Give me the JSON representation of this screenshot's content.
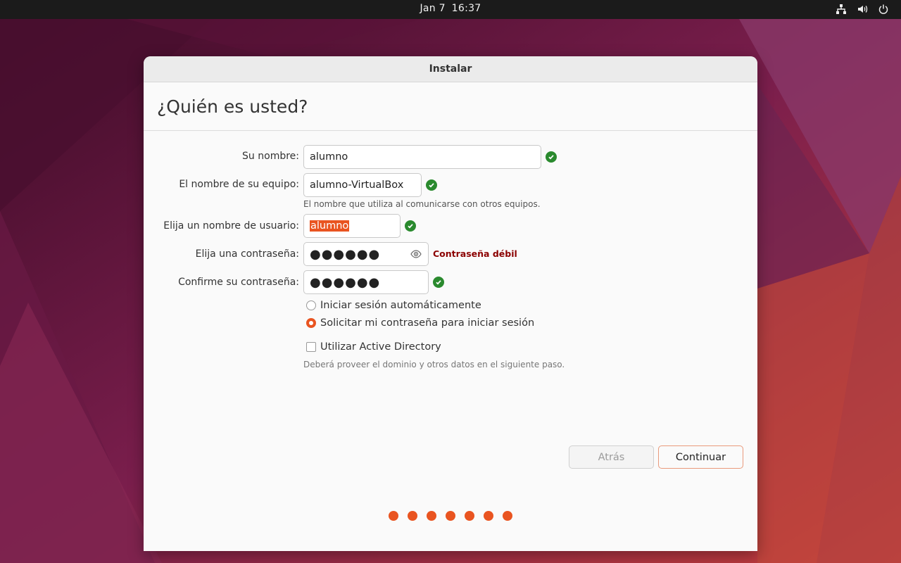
{
  "topbar": {
    "date": "Jan 7",
    "time": "16:37",
    "icons": [
      "network-icon",
      "volume-icon",
      "power-icon"
    ]
  },
  "window": {
    "title": "Instalar",
    "heading": "¿Quién es usted?"
  },
  "form": {
    "name_label": "Su nombre:",
    "name_value": "alumno",
    "computer_label": "El nombre de su equipo:",
    "computer_value": "alumno-VirtualBox",
    "computer_hint": "El nombre que utiliza al comunicarse con otros equipos.",
    "username_label": "Elija un nombre de usuario:",
    "username_value": "alumno",
    "password_label": "Elija una contraseña:",
    "password_value": "●●●●●●",
    "password_strength": "Contraseña débil",
    "confirm_label": "Confirme su contraseña:",
    "confirm_value": "●●●●●●",
    "auto_login_label": "Iniciar sesión automáticamente",
    "require_password_label": "Solicitar mi contraseña para iniciar sesión",
    "active_directory_label": "Utilizar Active Directory",
    "active_directory_hint": "Deberá proveer el dominio y otros datos en el siguiente paso."
  },
  "buttons": {
    "back": "Atrás",
    "continue": "Continuar"
  },
  "progress": {
    "total_steps": 7
  },
  "colors": {
    "accent": "#e95420",
    "check": "#2a8a2e",
    "weak": "#8b0000"
  }
}
